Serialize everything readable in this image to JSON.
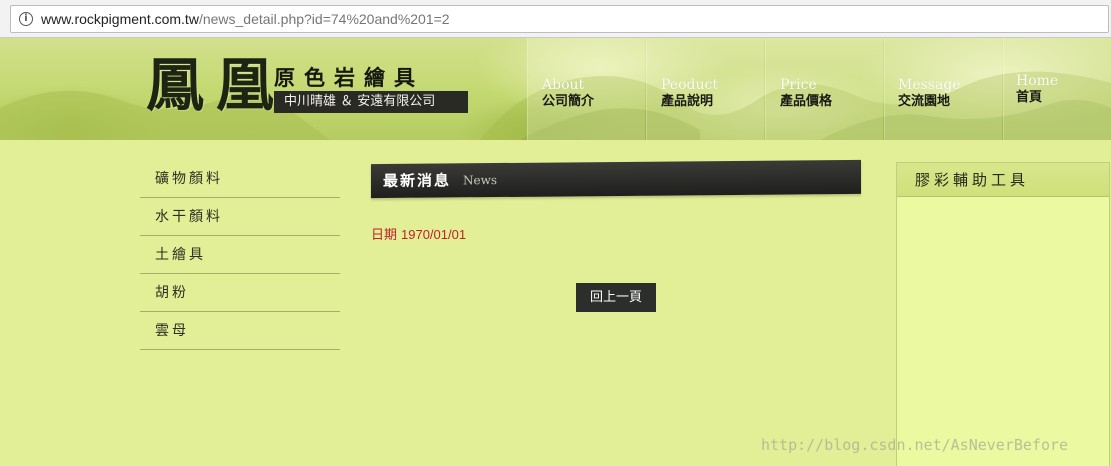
{
  "browser": {
    "url_domain": "www.rockpigment.com.tw",
    "url_path": "/news_detail.php?id=74%20and%201=2",
    "icon": "info-icon"
  },
  "header": {
    "logo_chars": "鳳凰",
    "site_title": "原色岩繪具",
    "site_subtitle": "中川晴雄 ＆ 安遠有限公司",
    "nav": [
      {
        "en": "About",
        "zh": "公司簡介"
      },
      {
        "en": "Peoduct",
        "zh": "產品說明"
      },
      {
        "en": "Price",
        "zh": "產品價格"
      },
      {
        "en": "Message",
        "zh": "交流園地"
      },
      {
        "en": "Home",
        "zh": "首頁"
      }
    ]
  },
  "sidebar": {
    "items": [
      "礦物顏料",
      "水干顏料",
      "土繪具",
      "胡粉",
      "雲母"
    ]
  },
  "main": {
    "section_zh": "最新消息",
    "section_en": "News",
    "date_label": "日期",
    "date_value": "1970/01/01",
    "back_button": "回上一頁"
  },
  "tools": {
    "title": "膠彩輔助工具"
  },
  "watermark": "http://blog.csdn.net/AsNeverBefore",
  "colors": {
    "page_bg": "#e2ef96",
    "date_red": "#c0202a",
    "dark_button": "#2c2e2b"
  }
}
